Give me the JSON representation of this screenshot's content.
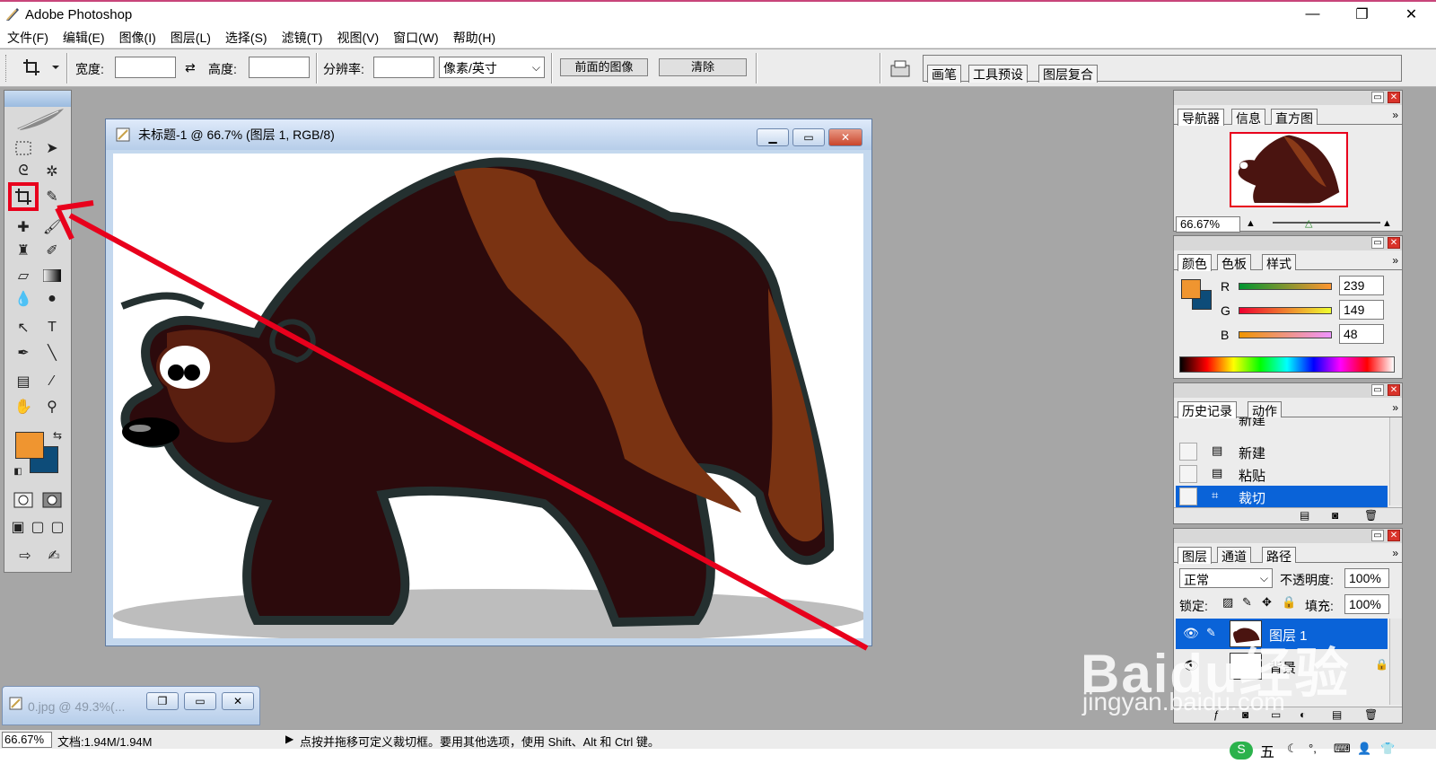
{
  "window": {
    "title": "Adobe Photoshop",
    "controls": [
      "—",
      "❐",
      "✕"
    ]
  },
  "menu": [
    "文件(F)",
    "编辑(E)",
    "图像(I)",
    "图层(L)",
    "选择(S)",
    "滤镜(T)",
    "视图(V)",
    "窗口(W)",
    "帮助(H)"
  ],
  "options": {
    "width_label": "宽度:",
    "swap_icon": "⇄",
    "height_label": "高度:",
    "resolution_label": "分辨率:",
    "unit_value": "像素/英寸",
    "front_image_button": "前面的图像",
    "clear_button": "清除",
    "well_tabs": [
      "画笔",
      "工具预设",
      "图层复合"
    ]
  },
  "document": {
    "title": "未标题-1 @ 66.7% (图层 1, RGB/8)"
  },
  "minimized_doc": {
    "title": "0.jpg @ 49.3%(..."
  },
  "status": {
    "zoom": "66.67%",
    "doc_size": "文档:1.94M/1.94M",
    "hint": "点按并拖移可定义裁切框。要用其他选项，使用 Shift、Alt 和 Ctrl 键。"
  },
  "navigator": {
    "tabs": [
      "导航器",
      "信息",
      "直方图"
    ],
    "zoom": "66.67%"
  },
  "color": {
    "tabs": [
      "颜色",
      "色板",
      "样式"
    ],
    "r_label": "R",
    "g_label": "G",
    "b_label": "B",
    "r": "239",
    "g": "149",
    "b": "48",
    "fg": "#ef9530",
    "bg": "#0d4c79"
  },
  "history": {
    "tabs": [
      "历史记录",
      "动作"
    ],
    "top_partial": "新建",
    "items": [
      "新建",
      "粘贴",
      "裁切"
    ]
  },
  "layers": {
    "tabs": [
      "图层",
      "通道",
      "路径"
    ],
    "blend_mode": "正常",
    "opacity_label": "不透明度:",
    "opacity": "100%",
    "lock_label": "锁定:",
    "fill_label": "填充:",
    "fill": "100%",
    "layer_name": "图层 1",
    "bg_layer_name": "背景"
  },
  "watermark": {
    "brand": "Baidu经验",
    "url": "jingyan.baidu.com"
  },
  "taskbar": {
    "ime": "五"
  },
  "accent": "#e8001c"
}
